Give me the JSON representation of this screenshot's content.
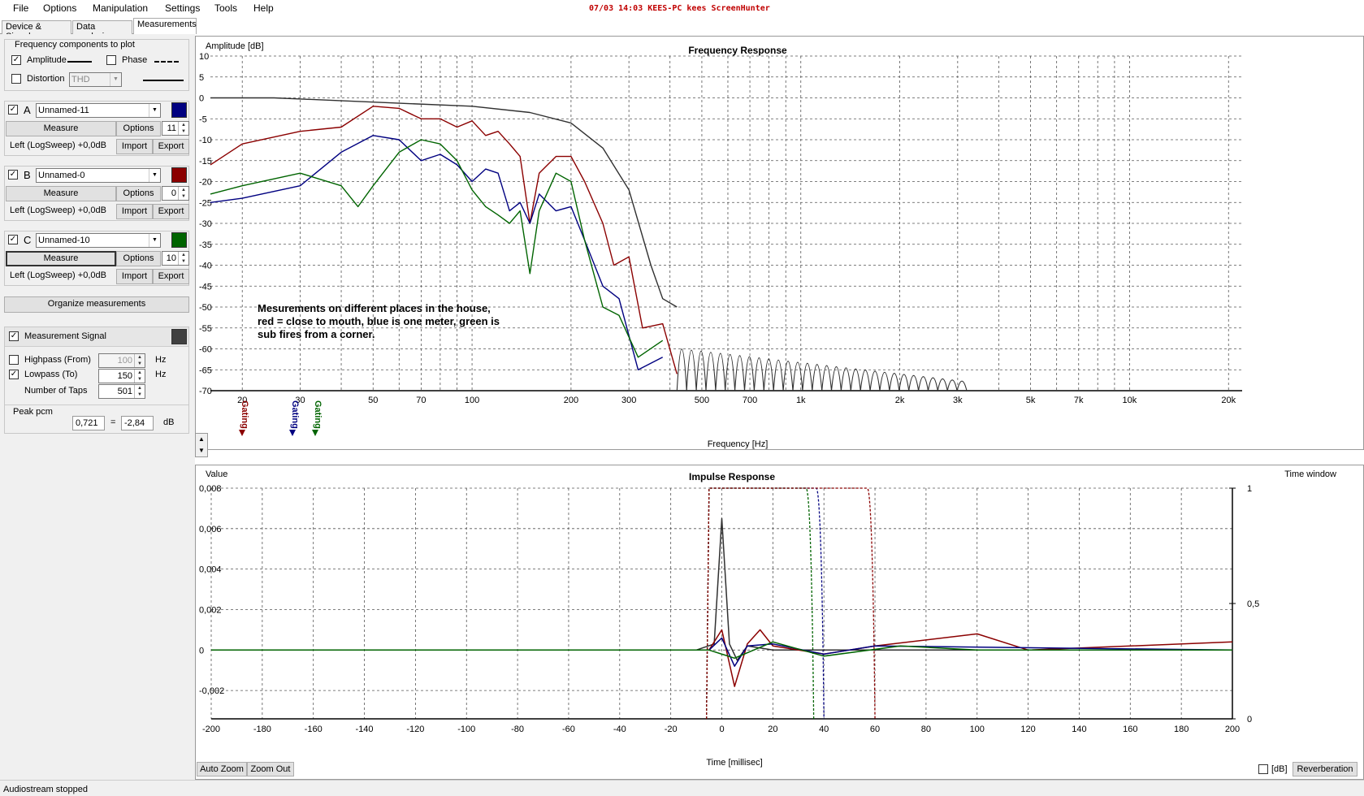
{
  "menu": [
    "File",
    "Options",
    "Manipulation",
    "Settings",
    "Tools",
    "Help"
  ],
  "screen_note": "07/03 14:03 KEES-PC kees ScreenHunter",
  "tabs": [
    "Device & Signal",
    "Data analysis",
    "Measurements"
  ],
  "freq_components": {
    "title": "Frequency components to plot",
    "amplitude": "Amplitude",
    "phase": "Phase",
    "distortion": "Distortion",
    "distortion_type": "THD"
  },
  "measurements": [
    {
      "letter": "A",
      "name": "Unnamed-11",
      "color": "#000080",
      "measure": "Measure",
      "options": "Options",
      "count": "11",
      "info": "Left (LogSweep) +0,0dB",
      "import": "Import",
      "export": "Export"
    },
    {
      "letter": "B",
      "name": "Unnamed-0",
      "color": "#8b0000",
      "measure": "Measure",
      "options": "Options",
      "count": "0",
      "info": "Left (LogSweep) +0,0dB",
      "import": "Import",
      "export": "Export"
    },
    {
      "letter": "C",
      "name": "Unnamed-10",
      "color": "#006400",
      "measure": "Measure",
      "options": "Options",
      "count": "10",
      "info": "Left (LogSweep) +0,0dB",
      "import": "Import",
      "export": "Export"
    }
  ],
  "organize_label": "Organize measurements",
  "signal": {
    "label": "Measurement Signal",
    "color": "#404040",
    "highpass": "Highpass (From)",
    "highpass_value": "100",
    "lowpass": "Lowpass (To)",
    "lowpass_value": "150",
    "hz": "Hz",
    "taps_label": "Number of Taps",
    "taps_value": "501"
  },
  "peak": {
    "label": "Peak pcm",
    "value": "0,721",
    "eq": "=",
    "db_value": "-2,84",
    "unit": "dB"
  },
  "freq_chart": {
    "title": "Frequency Response",
    "ylabel": "Amplitude [dB]",
    "xlabel": "Frequency [Hz]",
    "y_ticks": [
      "10",
      "5",
      "0",
      "-5",
      "-10",
      "-15",
      "-20",
      "-25",
      "-30",
      "-35",
      "-40",
      "-45",
      "-50",
      "-55",
      "-60",
      "-65",
      "-70"
    ],
    "x_ticks": [
      {
        "f": 20,
        "l": "20"
      },
      {
        "f": 30,
        "l": "30"
      },
      {
        "f": 50,
        "l": "50"
      },
      {
        "f": 70,
        "l": "70"
      },
      {
        "f": 100,
        "l": "100"
      },
      {
        "f": 200,
        "l": "200"
      },
      {
        "f": 300,
        "l": "300"
      },
      {
        "f": 500,
        "l": "500"
      },
      {
        "f": 700,
        "l": "700"
      },
      {
        "f": 1000,
        "l": "1k"
      },
      {
        "f": 2000,
        "l": "2k"
      },
      {
        "f": 3000,
        "l": "3k"
      },
      {
        "f": 5000,
        "l": "5k"
      },
      {
        "f": 7000,
        "l": "7k"
      },
      {
        "f": 10000,
        "l": "10k"
      },
      {
        "f": 20000,
        "l": "20k"
      }
    ],
    "annotation": [
      "Mesurements on different places in the house,",
      "red = close to mouth, blue is one meter, green is",
      "sub fires from a corner."
    ],
    "gating_label": "Gating"
  },
  "impulse_chart": {
    "title": "Impulse Response",
    "ylabel": "Value",
    "y2label": "Time window",
    "xlabel": "Time [millisec]",
    "y_ticks": [
      "0,008",
      "0,006",
      "0,004",
      "0,002",
      "0",
      "-0,002"
    ],
    "y2_ticks": [
      "1",
      "0,5",
      "0"
    ],
    "x_ticks": [
      "-200",
      "-180",
      "-160",
      "-140",
      "-120",
      "-100",
      "-80",
      "-60",
      "-40",
      "-20",
      "0",
      "20",
      "40",
      "60",
      "80",
      "100",
      "120",
      "140",
      "160",
      "180",
      "200"
    ]
  },
  "buttons": {
    "auto_zoom": "Auto Zoom",
    "zoom_out": "Zoom Out",
    "db": "[dB]",
    "reverberation": "Reverberation"
  },
  "status": "Audiostream stopped",
  "chart_data": [
    {
      "type": "line",
      "title": "Frequency Response",
      "xlabel": "Frequency [Hz]",
      "ylabel": "Amplitude [dB]",
      "xscale": "log",
      "xlim": [
        16,
        22000
      ],
      "ylim": [
        -70,
        10
      ],
      "grid": true,
      "series": [
        {
          "color": "#303030",
          "points": [
            [
              16,
              0
            ],
            [
              25,
              0
            ],
            [
              50,
              -1
            ],
            [
              100,
              -2
            ],
            [
              150,
              -3.5
            ],
            [
              200,
              -6
            ],
            [
              250,
              -12
            ],
            [
              300,
              -22
            ],
            [
              350,
              -40
            ],
            [
              380,
              -48
            ],
            [
              420,
              -50
            ]
          ]
        },
        {
          "color": "#8b0000",
          "points": [
            [
              16,
              -16
            ],
            [
              20,
              -11
            ],
            [
              30,
              -8
            ],
            [
              40,
              -7
            ],
            [
              50,
              -2
            ],
            [
              60,
              -2.5
            ],
            [
              70,
              -5
            ],
            [
              80,
              -5
            ],
            [
              90,
              -7
            ],
            [
              100,
              -5.5
            ],
            [
              110,
              -9
            ],
            [
              120,
              -8
            ],
            [
              130,
              -11
            ],
            [
              140,
              -14
            ],
            [
              150,
              -30
            ],
            [
              160,
              -18
            ],
            [
              180,
              -14
            ],
            [
              200,
              -14
            ],
            [
              220,
              -20
            ],
            [
              250,
              -30
            ],
            [
              270,
              -40
            ],
            [
              300,
              -38
            ],
            [
              330,
              -55
            ],
            [
              380,
              -54
            ],
            [
              420,
              -66
            ]
          ]
        },
        {
          "color": "#000080",
          "points": [
            [
              16,
              -25
            ],
            [
              20,
              -24
            ],
            [
              30,
              -21
            ],
            [
              40,
              -13
            ],
            [
              50,
              -9
            ],
            [
              60,
              -10
            ],
            [
              70,
              -15
            ],
            [
              80,
              -13.5
            ],
            [
              90,
              -16
            ],
            [
              100,
              -20
            ],
            [
              110,
              -17
            ],
            [
              120,
              -18
            ],
            [
              130,
              -27
            ],
            [
              140,
              -25
            ],
            [
              150,
              -30
            ],
            [
              160,
              -23
            ],
            [
              180,
              -27
            ],
            [
              200,
              -26
            ],
            [
              220,
              -34
            ],
            [
              250,
              -45
            ],
            [
              280,
              -48
            ],
            [
              320,
              -65
            ],
            [
              380,
              -62
            ]
          ]
        },
        {
          "color": "#006400",
          "points": [
            [
              16,
              -23
            ],
            [
              20,
              -21
            ],
            [
              30,
              -18
            ],
            [
              40,
              -21
            ],
            [
              45,
              -26
            ],
            [
              50,
              -21
            ],
            [
              60,
              -13
            ],
            [
              70,
              -10
            ],
            [
              80,
              -11
            ],
            [
              90,
              -15
            ],
            [
              100,
              -22
            ],
            [
              110,
              -26
            ],
            [
              120,
              -28
            ],
            [
              130,
              -30
            ],
            [
              140,
              -27
            ],
            [
              150,
              -42
            ],
            [
              160,
              -27
            ],
            [
              180,
              -18
            ],
            [
              200,
              -20
            ],
            [
              220,
              -34
            ],
            [
              250,
              -50
            ],
            [
              280,
              -52
            ],
            [
              320,
              -62
            ],
            [
              380,
              -58
            ]
          ]
        }
      ]
    },
    {
      "type": "line",
      "title": "Impulse Response",
      "xlabel": "Time [millisec]",
      "ylabel": "Value",
      "xlim": [
        -200,
        200
      ],
      "ylim": [
        -0.0034,
        0.008
      ],
      "grid": true,
      "series": [
        {
          "color": "#303030",
          "points": [
            [
              -200,
              0
            ],
            [
              -10,
              0
            ],
            [
              -3,
              0.0003
            ],
            [
              0,
              0.0065
            ],
            [
              3,
              0.0003
            ],
            [
              6,
              -0.0005
            ],
            [
              10,
              0.0002
            ],
            [
              20,
              0
            ],
            [
              200,
              0
            ]
          ]
        },
        {
          "color": "#8b0000",
          "points": [
            [
              -200,
              0
            ],
            [
              -5,
              0
            ],
            [
              0,
              0.001
            ],
            [
              5,
              -0.0018
            ],
            [
              10,
              0.0003
            ],
            [
              15,
              0.001
            ],
            [
              20,
              0.0002
            ],
            [
              40,
              -0.0002
            ],
            [
              60,
              0.0002
            ],
            [
              100,
              0.0008
            ],
            [
              120,
              0
            ],
            [
              200,
              0.0004
            ]
          ]
        },
        {
          "color": "#000080",
          "points": [
            [
              -200,
              0
            ],
            [
              -5,
              0
            ],
            [
              0,
              0.0006
            ],
            [
              5,
              -0.0008
            ],
            [
              10,
              0.0002
            ],
            [
              20,
              0.0003
            ],
            [
              40,
              -0.0002
            ],
            [
              60,
              0.0002
            ],
            [
              200,
              0
            ]
          ]
        },
        {
          "color": "#006400",
          "points": [
            [
              -200,
              0
            ],
            [
              -5,
              0
            ],
            [
              5,
              -0.0004
            ],
            [
              20,
              0.0004
            ],
            [
              40,
              -0.0003
            ],
            [
              70,
              0.0002
            ],
            [
              100,
              0
            ],
            [
              200,
              0
            ]
          ]
        }
      ],
      "time_windows": [
        {
          "color": "#000080",
          "start": -5,
          "end": 40
        },
        {
          "color": "#006400",
          "start": -5,
          "end": 36
        },
        {
          "color": "#8b0000",
          "start": -5,
          "end": 60
        }
      ]
    }
  ]
}
